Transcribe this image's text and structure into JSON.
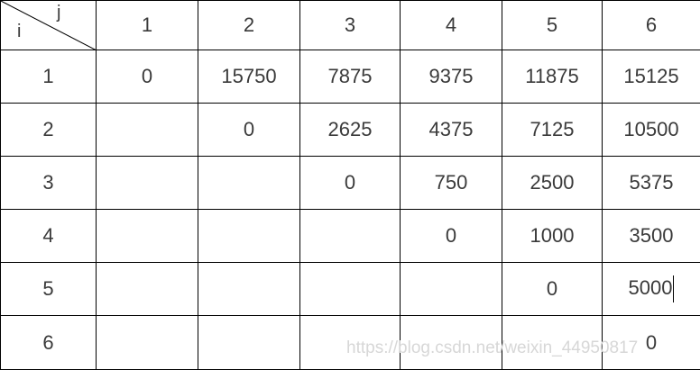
{
  "corner": {
    "row_label": "i",
    "col_label": "j"
  },
  "columns": [
    "1",
    "2",
    "3",
    "4",
    "5",
    "6"
  ],
  "rows": [
    {
      "label": "1",
      "cells": [
        "0",
        "15750",
        "7875",
        "9375",
        "11875",
        "15125"
      ]
    },
    {
      "label": "2",
      "cells": [
        "",
        "0",
        "2625",
        "4375",
        "7125",
        "10500"
      ]
    },
    {
      "label": "3",
      "cells": [
        "",
        "",
        "0",
        "750",
        "2500",
        "5375"
      ]
    },
    {
      "label": "4",
      "cells": [
        "",
        "",
        "",
        "0",
        "1000",
        "3500"
      ]
    },
    {
      "label": "5",
      "cells": [
        "",
        "",
        "",
        "",
        "0",
        "5000"
      ]
    },
    {
      "label": "6",
      "cells": [
        "",
        "",
        "",
        "",
        "",
        "0"
      ]
    }
  ],
  "watermark": "https://blog.csdn.net/weixin_44950817"
}
